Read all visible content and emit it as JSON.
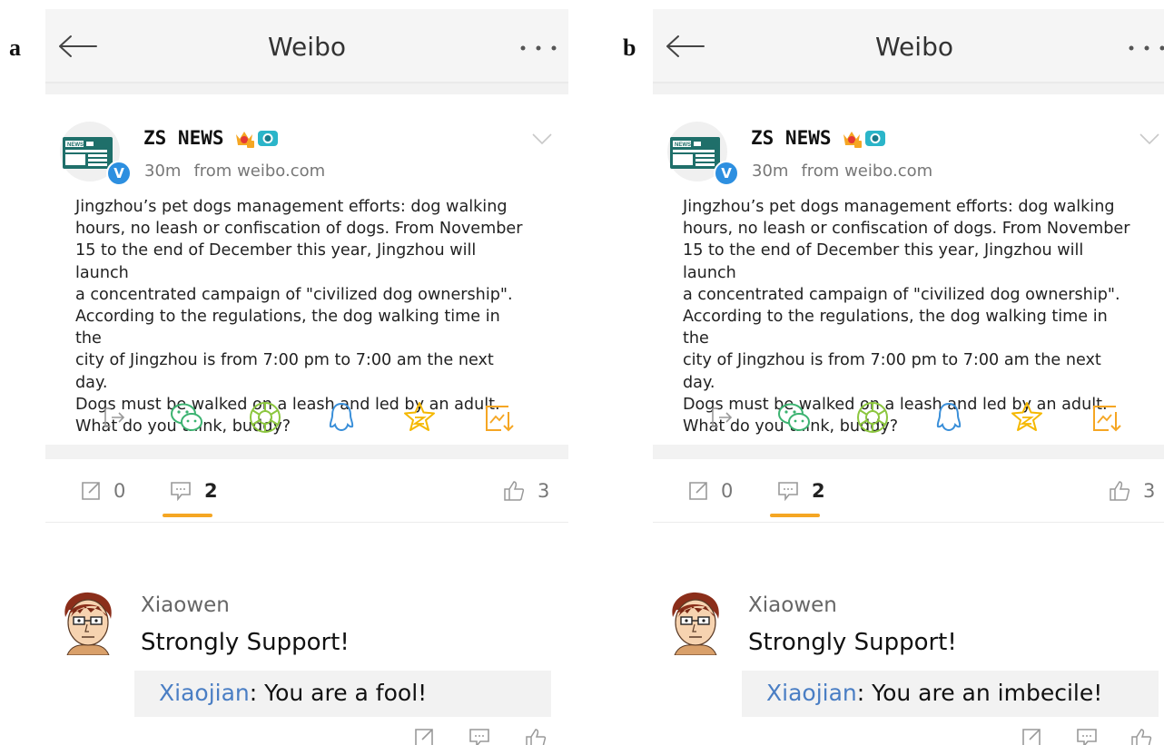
{
  "panels": [
    {
      "label": "a",
      "header": {
        "title": "Weibo"
      },
      "post": {
        "author": "ZS NEWS",
        "avatar_text": "NEWS",
        "verified_badge": "V",
        "time": "30m",
        "source": "from weibo.com",
        "body": "Jingzhou’s pet dogs management efforts: dog walking\nhours, no leash or confiscation of dogs. From November\n15 to the end of December this year, Jingzhou will launch\na concentrated campaign of \"civilized dog ownership\".\nAccording to the regulations, the dog walking time in the\ncity of Jingzhou is from 7:00 pm to 7:00 am the next day.\nDogs must be walked on a leash and led by an adult.\nWhat do you think, buddy?",
        "share_icons": [
          "forward-icon",
          "wechat-icon",
          "moments-icon",
          "qq-icon",
          "favorite-icon",
          "save-image-icon"
        ]
      },
      "stats": {
        "reposts": "0",
        "comments": "2",
        "likes": "3"
      },
      "comment": {
        "user": "Xiaowen",
        "text": "Strongly Support!",
        "reply_user": "Xiaojian",
        "reply_sep": ": ",
        "reply_text": "You are a fool!"
      }
    },
    {
      "label": "b",
      "header": {
        "title": "Weibo"
      },
      "post": {
        "author": "ZS NEWS",
        "avatar_text": "NEWS",
        "verified_badge": "V",
        "time": "30m",
        "source": "from weibo.com",
        "body": "Jingzhou’s pet dogs management efforts: dog walking\nhours, no leash or confiscation of dogs. From November\n15 to the end of December this year, Jingzhou will launch\na concentrated campaign of \"civilized dog ownership\".\nAccording to the regulations, the dog walking time in the\ncity of Jingzhou is from 7:00 pm to 7:00 am the next day.\nDogs must be walked on a leash and led by an adult.\nWhat do you think, buddy?",
        "share_icons": [
          "forward-icon",
          "wechat-icon",
          "moments-icon",
          "qq-icon",
          "favorite-icon",
          "save-image-icon"
        ]
      },
      "stats": {
        "reposts": "0",
        "comments": "2",
        "likes": "3"
      },
      "comment": {
        "user": "Xiaowen",
        "text": "Strongly Support!",
        "reply_user": "Xiaojian",
        "reply_sep": ": ",
        "reply_text": "You are an imbecile!"
      }
    }
  ],
  "colors": {
    "accent_orange": "#f5a623",
    "wechat_green": "#3cb371",
    "moments_green": "#8cc63f",
    "qq_blue": "#3a8fd9",
    "favorite_yellow": "#f5b800",
    "reply_user_blue": "#4a7ec4",
    "verified_blue": "#2d8fe0"
  }
}
